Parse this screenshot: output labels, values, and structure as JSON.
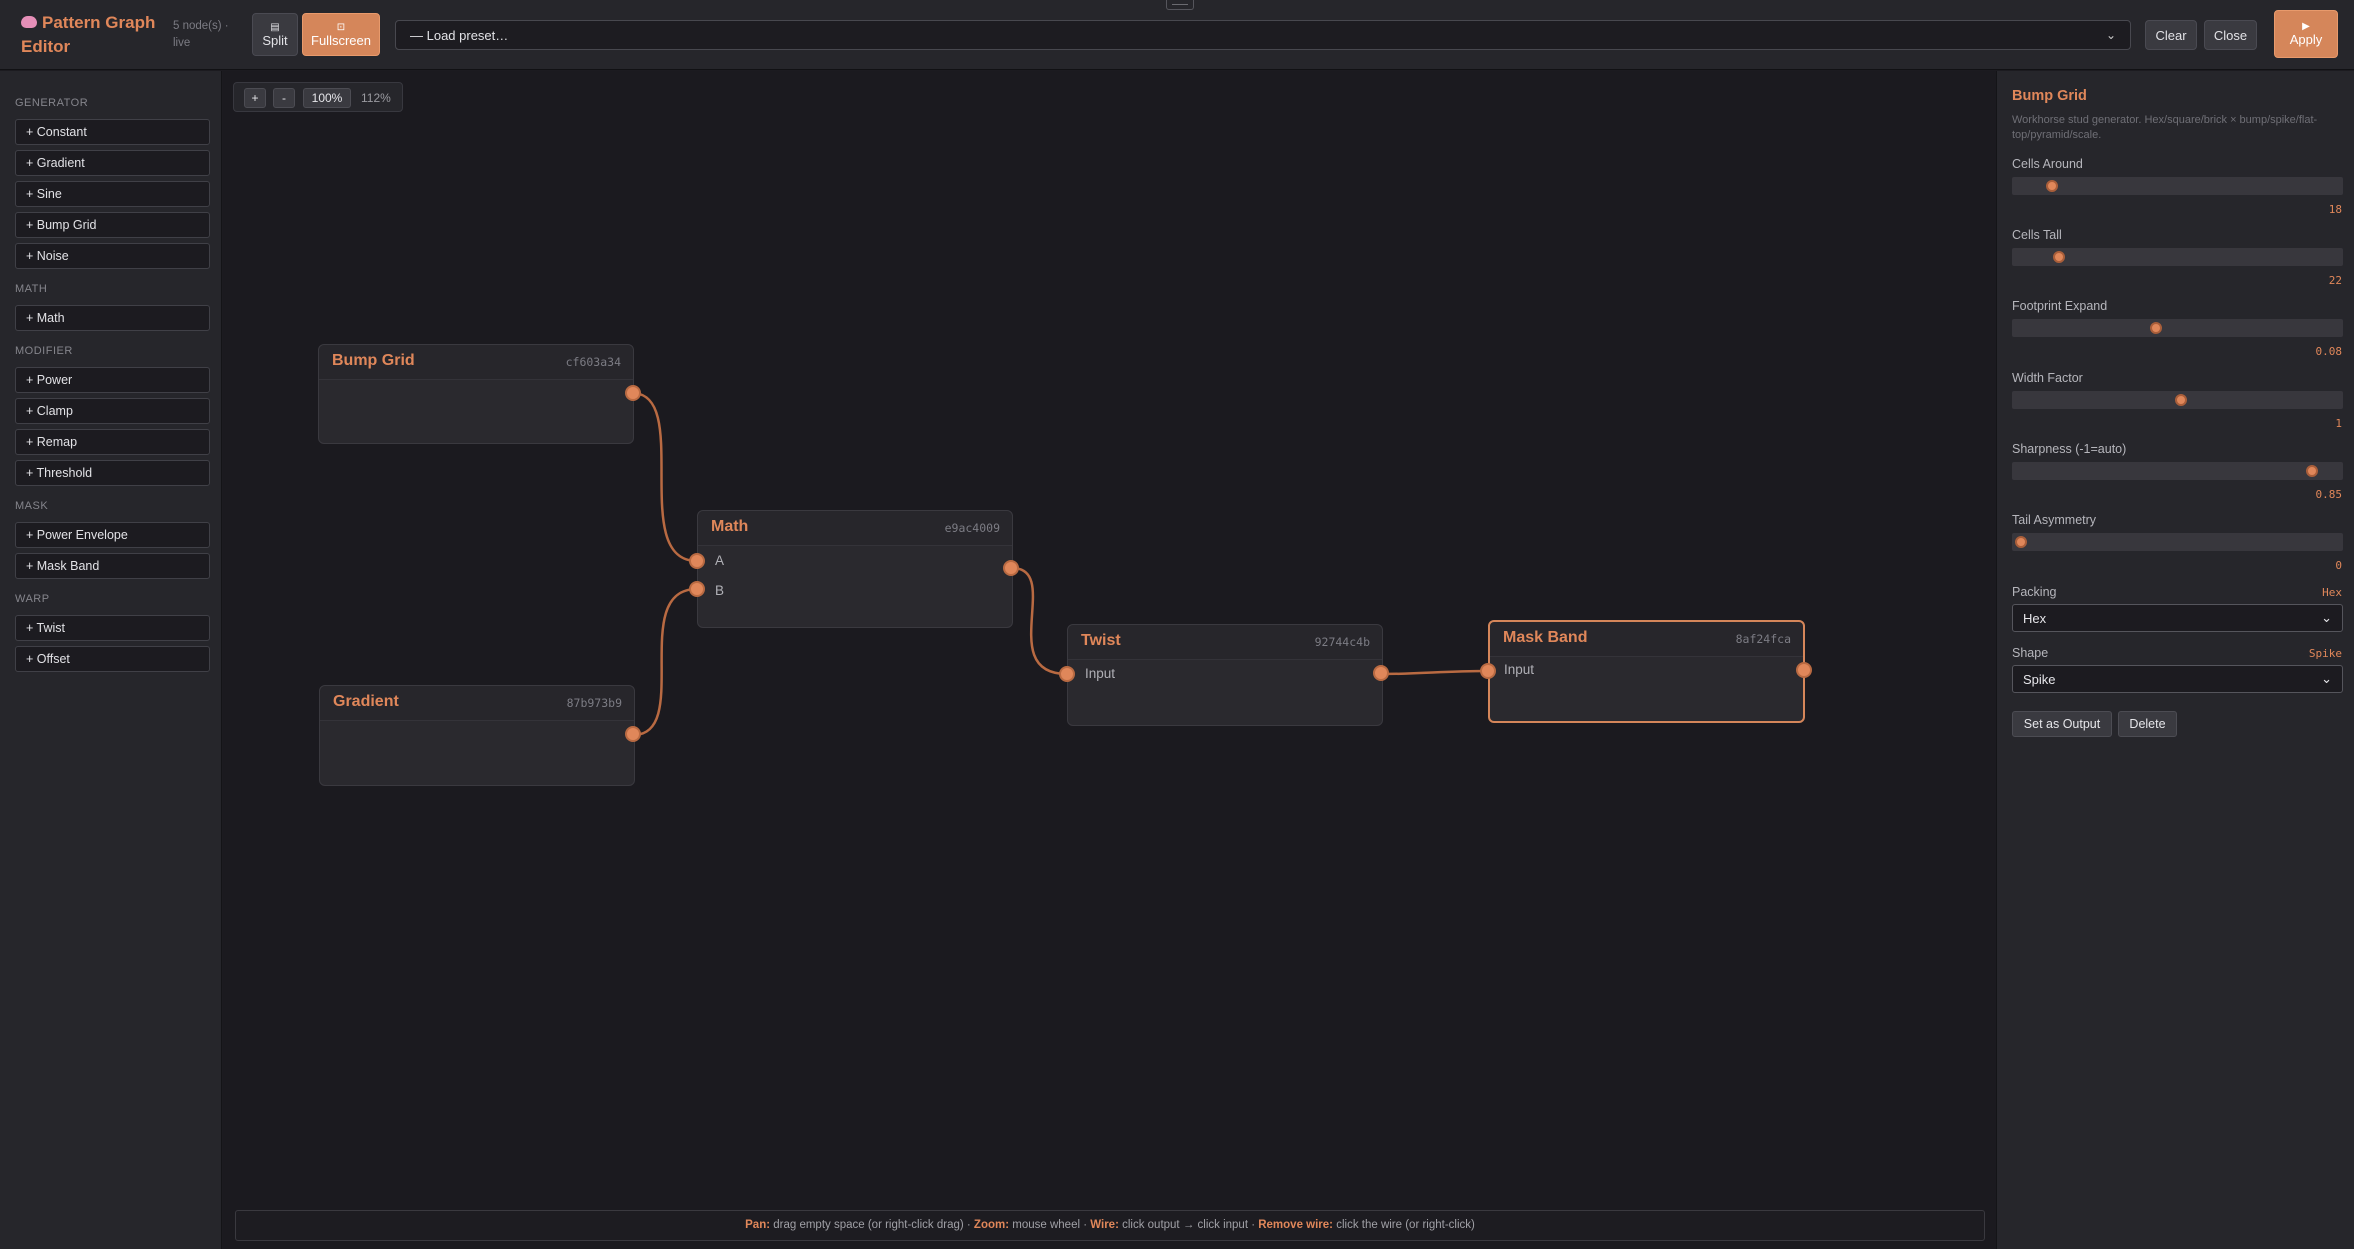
{
  "header": {
    "title": "Pattern Graph Editor",
    "node_count": "5 node(s) · live",
    "split_label": "Split",
    "fullscreen_label": "Fullscreen",
    "preset_placeholder": "— Load preset…",
    "clear_label": "Clear",
    "close_label": "Close",
    "apply_label": "Apply"
  },
  "palette": {
    "categories": [
      {
        "name": "GENERATOR",
        "items": [
          "+ Constant",
          "+ Gradient",
          "+ Sine",
          "+ Bump Grid",
          "+ Noise"
        ]
      },
      {
        "name": "MATH",
        "items": [
          "+ Math"
        ]
      },
      {
        "name": "MODIFIER",
        "items": [
          "+ Power",
          "+ Clamp",
          "+ Remap",
          "+ Threshold"
        ]
      },
      {
        "name": "MASK",
        "items": [
          "+ Power Envelope",
          "+ Mask Band"
        ]
      },
      {
        "name": "WARP",
        "items": [
          "+ Twist",
          "+ Offset"
        ]
      }
    ]
  },
  "canvas": {
    "zoom_in": "+",
    "zoom_out": "-",
    "zoom_reset": "100%",
    "zoom_level": "112%",
    "nodes": {
      "bump_grid": {
        "title": "Bump Grid",
        "id": "cf603a34"
      },
      "gradient": {
        "title": "Gradient",
        "id": "87b973b9"
      },
      "math": {
        "title": "Math",
        "id": "e9ac4009",
        "input_a": "A",
        "input_b": "B"
      },
      "twist": {
        "title": "Twist",
        "id": "92744c4b",
        "input": "Input"
      },
      "mask_band": {
        "title": "Mask Band",
        "id": "8af24fca",
        "input": "Input"
      }
    },
    "help": {
      "pan_key": "Pan:",
      "pan_text": " drag empty space (or right-click drag) · ",
      "zoom_key": "Zoom:",
      "zoom_text": " mouse wheel · ",
      "wire_key": "Wire:",
      "wire_text": " click output → click input · ",
      "remove_key": "Remove wire:",
      "remove_text": " click the wire (or right-click)"
    }
  },
  "inspector": {
    "title": "Bump Grid",
    "description": "Workhorse stud generator. Hex/square/brick × bump/spike/flat-top/pyramid/scale.",
    "params": [
      {
        "label": "Cells Around",
        "value": "18",
        "fraction": 0.1
      },
      {
        "label": "Cells Tall",
        "value": "22",
        "fraction": 0.12
      },
      {
        "label": "Footprint Expand",
        "value": "0.08",
        "fraction": 0.43
      },
      {
        "label": "Width Factor",
        "value": "1",
        "fraction": 0.51
      },
      {
        "label": "Sharpness (-1=auto)",
        "value": "0.85",
        "fraction": 0.93
      },
      {
        "label": "Tail Asymmetry",
        "value": "0",
        "fraction": 0.0
      }
    ],
    "packing": {
      "label": "Packing",
      "value": "Hex",
      "selected": "Hex"
    },
    "shape": {
      "label": "Shape",
      "value": "Spike",
      "selected": "Spike"
    },
    "set_output_label": "Set as Output",
    "delete_label": "Delete"
  },
  "colors": {
    "accent": "#e0875a",
    "background": "#1b1a1f",
    "panel": "#26262b",
    "node": "#2a292e"
  }
}
